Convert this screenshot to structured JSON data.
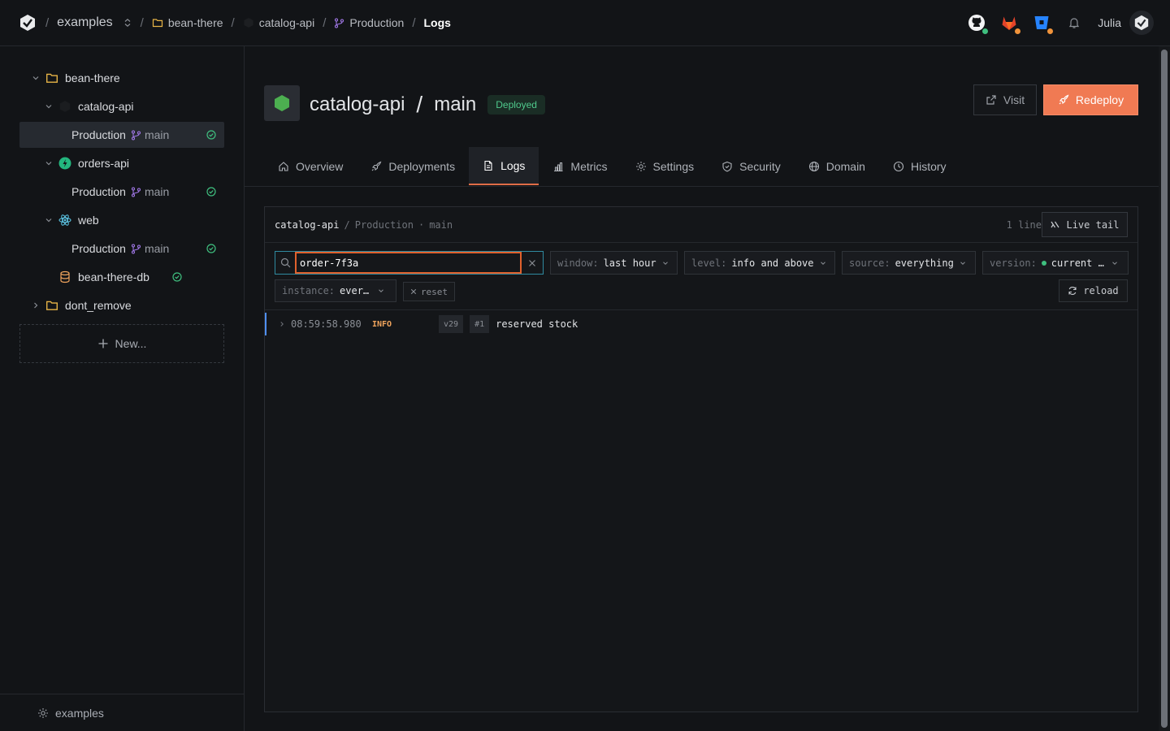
{
  "topbar": {
    "breadcrumbs": {
      "workspace": "examples",
      "project": "bean-there",
      "service": "catalog-api",
      "environment": "Production",
      "page": "Logs"
    },
    "user": {
      "name": "Julia"
    },
    "providers": [
      {
        "icon": "github-icon",
        "status_color": "#3fbf7f"
      },
      {
        "icon": "gitlab-icon",
        "status_color": "#f0933b"
      },
      {
        "icon": "bitbucket-icon",
        "status_color": "#f0933b"
      }
    ]
  },
  "sidebar": {
    "tree": [
      {
        "label": "bean-there",
        "type": "project"
      },
      {
        "label": "catalog-api",
        "type": "service"
      },
      {
        "label": "Production",
        "branch": "main",
        "status": "ok",
        "selected": true
      },
      {
        "label": "orders-api",
        "type": "service"
      },
      {
        "label": "Production",
        "branch": "main",
        "status": "ok"
      },
      {
        "label": "web",
        "type": "service"
      },
      {
        "label": "Production",
        "branch": "main",
        "status": "ok"
      },
      {
        "label": "bean-there-db",
        "type": "database",
        "status": "ok"
      },
      {
        "label": "dont_remove",
        "type": "project"
      }
    ],
    "new_label": "New...",
    "footer_label": "examples"
  },
  "service": {
    "name": "catalog-api",
    "branch": "main",
    "status_badge": "Deployed",
    "visit_label": "Visit",
    "redeploy_label": "Redeploy"
  },
  "tabs": [
    {
      "label": "Overview",
      "icon": "home-icon"
    },
    {
      "label": "Deployments",
      "icon": "rocket-icon"
    },
    {
      "label": "Logs",
      "icon": "file-icon",
      "active": true
    },
    {
      "label": "Metrics",
      "icon": "bar-chart-icon"
    },
    {
      "label": "Settings",
      "icon": "gear-icon"
    },
    {
      "label": "Security",
      "icon": "shield-icon"
    },
    {
      "label": "Domain",
      "icon": "globe-icon"
    },
    {
      "label": "History",
      "icon": "clock-icon"
    }
  ],
  "logs": {
    "header": {
      "service": "catalog-api",
      "environment": "Production",
      "branch": "main",
      "line_count": "1 line"
    },
    "live_tail_label": "Live tail",
    "search": {
      "value": "order-7f3a"
    },
    "filters": {
      "window": {
        "key": "window:",
        "value": "last hour"
      },
      "level": {
        "key": "level:",
        "value": "info and above"
      },
      "source": {
        "key": "source:",
        "value": "everything"
      },
      "version": {
        "key": "version:",
        "value": "current …"
      },
      "instance": {
        "key": "instance:",
        "value": "ever…"
      }
    },
    "reset_label": "reset",
    "reload_label": "reload",
    "entries": [
      {
        "timestamp": "08:59:58.980",
        "level": "INFO",
        "version": "v29",
        "instance": "#1",
        "message": "reserved stock"
      }
    ]
  },
  "colors": {
    "accent": "#f07a53",
    "deployed": "#4fc98c",
    "info": "#f0a45d",
    "search_border": "#e0612d"
  }
}
